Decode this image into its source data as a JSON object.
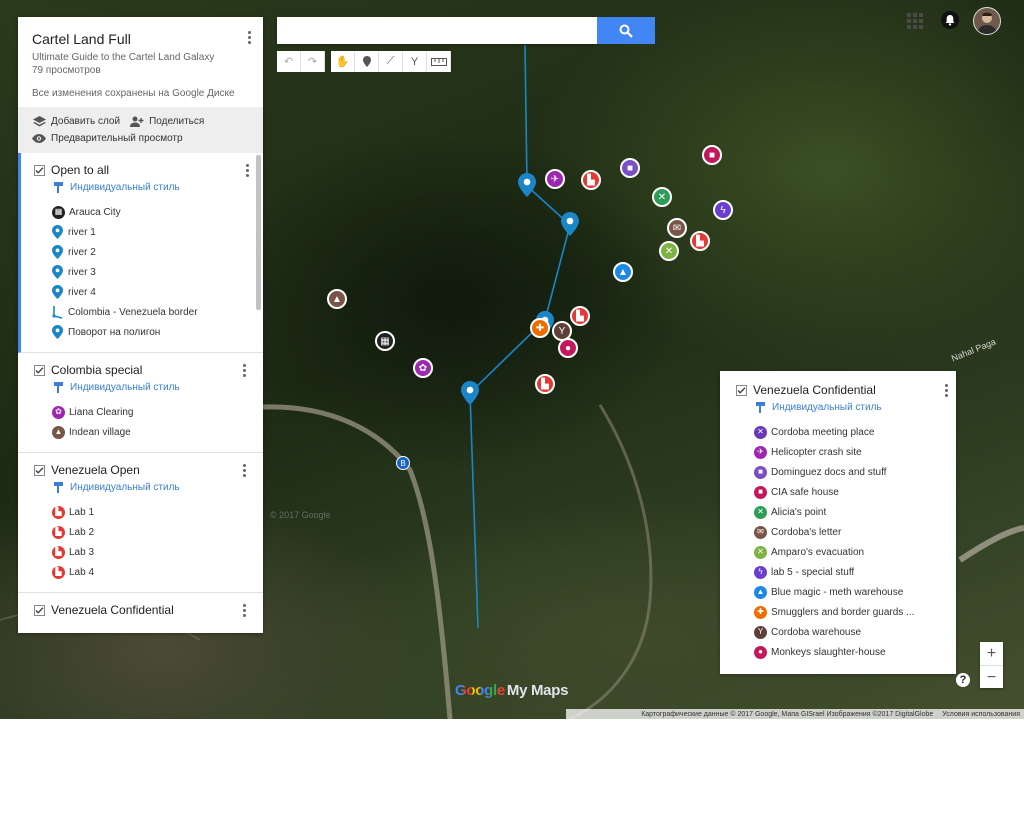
{
  "map_doc": {
    "title": "Cartel Land Full",
    "description": "Ultimate Guide to the Cartel Land Galaxy",
    "views": "79 просмотров",
    "saved_status": "Все изменения сохранены на Google Диске"
  },
  "actions": {
    "add_layer": "Добавить слой",
    "share": "Поделиться",
    "preview": "Предварительный просмотр"
  },
  "layers": [
    {
      "name": "Open to all",
      "style": "Индивидуальный стиль",
      "items": [
        {
          "label": "Arauca City",
          "icon": "building-icon",
          "color": "#212121"
        },
        {
          "label": "river 1",
          "icon": "pin-icon",
          "color": "#1a86c8"
        },
        {
          "label": "river 2",
          "icon": "pin-icon",
          "color": "#1a86c8"
        },
        {
          "label": "river 3",
          "icon": "pin-icon",
          "color": "#1a86c8"
        },
        {
          "label": "river 4",
          "icon": "pin-icon",
          "color": "#1a86c8"
        },
        {
          "label": "Colombia - Venezuela border",
          "icon": "line-icon",
          "color": "#1a86c8"
        },
        {
          "label": "Поворот на полигон",
          "icon": "pin-icon",
          "color": "#1a86c8"
        }
      ]
    },
    {
      "name": "Colombia special",
      "style": "Индивидуальный стиль",
      "items": [
        {
          "label": "Liana Clearing",
          "icon": "flower-icon",
          "color": "#9c27b0"
        },
        {
          "label": "Indean village",
          "icon": "tent-icon",
          "color": "#795548"
        }
      ]
    },
    {
      "name": "Venezuela Open",
      "style": "Индивидуальный стиль",
      "items": [
        {
          "label": "Lab 1",
          "icon": "factory-icon",
          "color": "#e53935"
        },
        {
          "label": "Lab 2",
          "icon": "factory-icon",
          "color": "#e53935"
        },
        {
          "label": "Lab 3",
          "icon": "factory-icon",
          "color": "#e53935"
        },
        {
          "label": "Lab 4",
          "icon": "factory-icon",
          "color": "#e53935"
        }
      ]
    },
    {
      "name": "Venezuela Confidential",
      "style": "",
      "items": []
    }
  ],
  "right_layer": {
    "name": "Venezuela Confidential",
    "style": "Индивидуальный стиль",
    "items": [
      {
        "label": "Cordoba meeting place",
        "icon": "handshake-icon",
        "color": "#673ab7",
        "glyph": "✕"
      },
      {
        "label": "Helicopter crash site",
        "icon": "helicopter-icon",
        "color": "#9c27b0",
        "glyph": "✈"
      },
      {
        "label": "Dominguez docs and stuff",
        "icon": "briefcase-icon",
        "color": "#7b4fc4",
        "glyph": "■"
      },
      {
        "label": "CIA safe house",
        "icon": "house-icon",
        "color": "#c2185b",
        "glyph": "■"
      },
      {
        "label": "Alicia's point",
        "icon": "crosshair-icon",
        "color": "#2e9b57",
        "glyph": "✕"
      },
      {
        "label": "Cordoba's letter",
        "icon": "mail-icon",
        "color": "#795548",
        "glyph": "✉"
      },
      {
        "label": "Amparo's evacuation",
        "icon": "arrows-icon",
        "color": "#7cb342",
        "glyph": "✕"
      },
      {
        "label": "lab 5 - special stuff",
        "icon": "lightning-icon",
        "color": "#6a3fd0",
        "glyph": "ϟ"
      },
      {
        "label": "Blue magic - meth warehouse",
        "icon": "flask-icon",
        "color": "#1e88e5",
        "glyph": "▲"
      },
      {
        "label": "Smugglers and border guards ...",
        "icon": "medkit-icon",
        "color": "#ef6c00",
        "glyph": "✚"
      },
      {
        "label": "Cordoba warehouse",
        "icon": "cocktail-icon",
        "color": "#5d4037",
        "glyph": "Y"
      },
      {
        "label": "Monkeys slaughter-house",
        "icon": "pig-icon",
        "color": "#c2185b",
        "glyph": "●"
      }
    ]
  },
  "search": {
    "placeholder": "",
    "value": ""
  },
  "map": {
    "place_label": "Nahal Paga",
    "faint_label": "© 2017 Google",
    "route_badge": "B",
    "logo_google": "Google",
    "logo_mymaps": "My Maps",
    "zoom_in": "+",
    "zoom_out": "−",
    "help": "?"
  },
  "attribution": {
    "data": "Картографические данные © 2017 Google, Мапа GISrael Изображения ©2017 DigitalGlobe",
    "terms": "Условия использования"
  },
  "colors": {
    "accent": "#4285f4",
    "river": "#1a86c8",
    "lab": "#e53935"
  }
}
